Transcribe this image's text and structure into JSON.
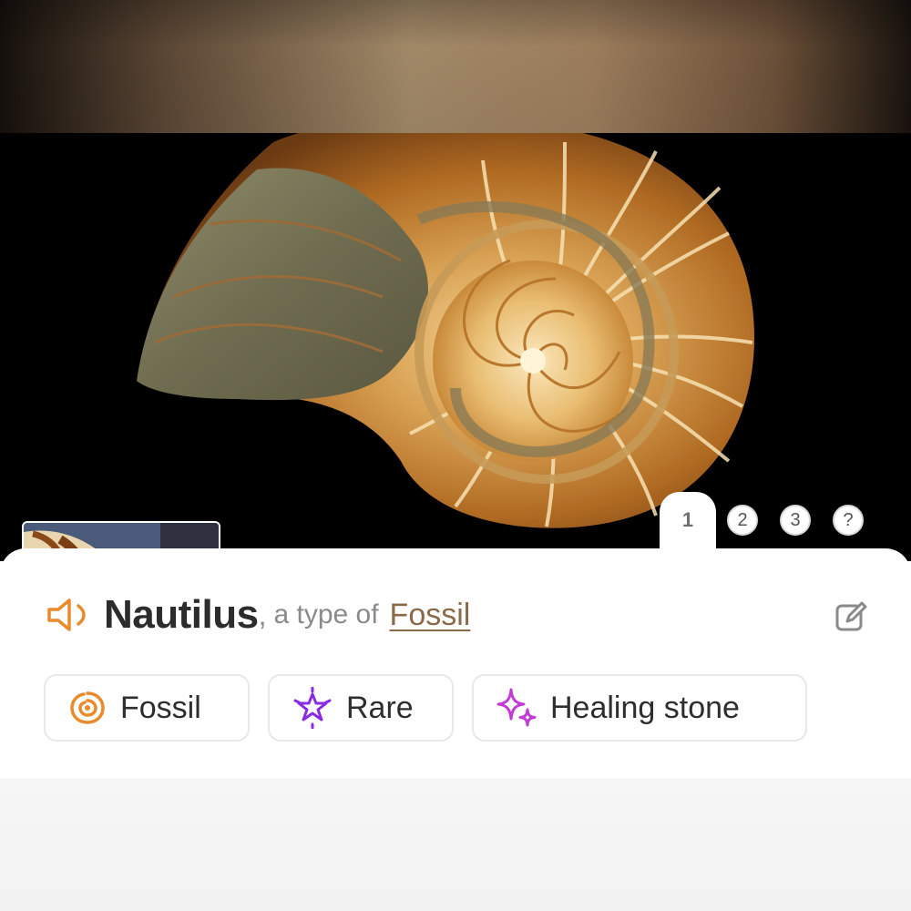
{
  "pager": {
    "tabs": [
      "1",
      "2",
      "3",
      "?"
    ],
    "active_index": 0
  },
  "result": {
    "name": "Nautilus",
    "separator": ",",
    "type_prefix": "a type of",
    "category_link": "Fossil"
  },
  "tags": [
    {
      "label": "Fossil",
      "icon": "ammonite-icon",
      "color": "#e98a2c"
    },
    {
      "label": "Rare",
      "icon": "sparkle-star-icon",
      "color": "#8a2be2"
    },
    {
      "label": "Healing stone",
      "icon": "sparkles-icon",
      "color": "#c23bd4"
    }
  ],
  "colors": {
    "accent_orange": "#e98a2c",
    "link_brown": "#8a6a48"
  }
}
